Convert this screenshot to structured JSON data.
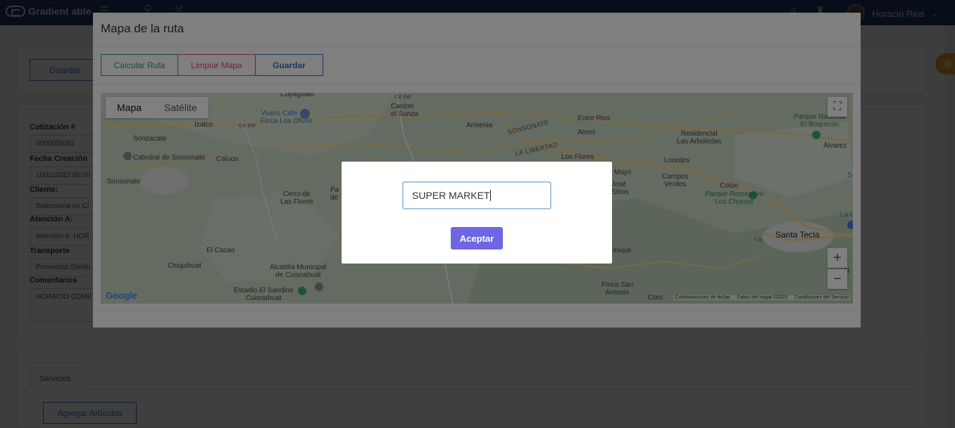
{
  "navbar": {
    "brand": "Gradient able",
    "user_name": "Horacio Rios"
  },
  "page": {
    "save_label": "Guardar",
    "fields": [
      {
        "label": "Cotización #",
        "value": "0000000001"
      },
      {
        "label": "Fecha Creación",
        "value": "10/11/2022 00:00"
      },
      {
        "label": "Cliente:",
        "value": "Selecciona un Cl"
      },
      {
        "label": "Atención A:",
        "value": "Atención A: HOR"
      },
      {
        "label": "Transporte",
        "value": "Proveedor:Sterlin"
      },
      {
        "label": "Comentarios",
        "value": "HORACIO COMET"
      }
    ],
    "tab_servicios": "Servicios",
    "add_items_label": "Agregar Artículos"
  },
  "modal": {
    "title": "Mapa de la ruta",
    "buttons": {
      "calcular": "Calcular Ruta",
      "limpiar": "Limpiar Mapa",
      "guardar": "Guardar"
    },
    "colors": {
      "calcular": "#2b9b7a",
      "limpiar": "#e0475c",
      "guardar": "#3a6fd1"
    }
  },
  "map": {
    "type_map": "Mapa",
    "type_satellite": "Satélite",
    "logo": "Google",
    "attribution": [
      "Combinaciones de teclas",
      "Datos del mapa ©2023",
      "Condiciones del Servicio"
    ],
    "places": {
      "cuyagualo": "Cuyagualo",
      "canton": "Canton\nel Sunza",
      "vivero": "Vivero Cafe\nFinca Los Olivos",
      "izalco": "Izalco",
      "sonzacate": "Sonzacate",
      "catedral": "Catedral de Sonsonate",
      "sonsonate": "Sonsonate",
      "caluco": "Caluco",
      "cerro": "Cerro de\nLas Flores",
      "armenia": "Armenia",
      "entre_rios": "Entre Rios",
      "ateos": "Ateos",
      "los_flores": "Los Flores",
      "residencial": "Residencial\nLas Arboledas",
      "parque_nacional": "Parque Nacional\nEl Boquerón",
      "alvarez": "Álvarez",
      "lourdes": "Lourdes",
      "campos": "Campos\nVerdes",
      "colon": "Colón",
      "parque_rec": "Parque Recreativo\nLos Chorros",
      "la_gran": "La Gran",
      "santa_tecla": "Santa Tecla",
      "mayo": "Mayo",
      "jose": "José\nSitios",
      "el_cacao": "El Cacao",
      "chiquihuat": "Chiquihuat",
      "alcaldia": "Alcaldía Municipal\nde Cuisnahuat",
      "estadio": "Estadio El Sandino\nCuisnahuat",
      "finca": "Finca San\nAntonio",
      "nique": "inique",
      "com": "Com",
      "pa": "Pa\nde",
      "s": "S",
      "cu": "Cu",
      "n": "N"
    },
    "roads": {
      "sonsonate": "SONSONATE",
      "libertad": "LA LIBERTAD",
      "ca8w_a": "CA 8W",
      "ca8w_b": "CA 8W",
      "lib": "Lib"
    }
  },
  "dialog": {
    "input_value": "SUPER MARKET",
    "accept_label": "Aceptar"
  }
}
